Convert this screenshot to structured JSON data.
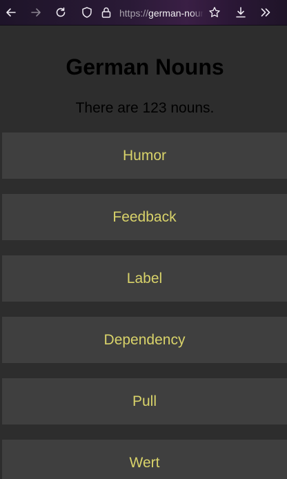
{
  "browser": {
    "url_scheme": "https://",
    "url_host": "german-nouns"
  },
  "page": {
    "title": "German Nouns",
    "count_text": "There are 123 nouns."
  },
  "nouns": [
    "Humor",
    "Feedback",
    "Label",
    "Dependency",
    "Pull",
    "Wert"
  ],
  "colors": {
    "background": "#2d2d2d",
    "card": "#3f3f3f",
    "noun_text": "#d9d36a",
    "heading_text": "#000000"
  },
  "icons": [
    "back-arrow-icon",
    "forward-arrow-icon",
    "reload-icon",
    "shield-icon",
    "lock-icon",
    "star-icon",
    "download-icon",
    "overflow-chevrons-icon"
  ]
}
